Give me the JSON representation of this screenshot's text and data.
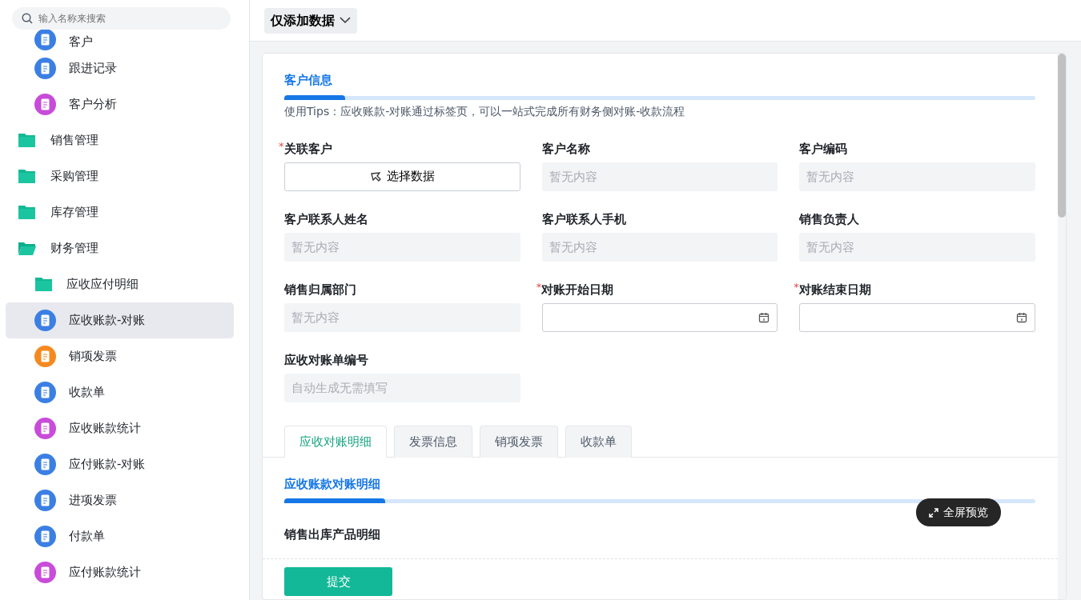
{
  "sidebar": {
    "search": {
      "placeholder": "输入名称来搜索"
    },
    "items": [
      {
        "children": [
          {
            "label": "客户",
            "kind": "app",
            "color": "#3b7fe4",
            "selected": false
          },
          {
            "label": "跟进记录",
            "kind": "app",
            "color": "#3b7fe4",
            "selected": false
          },
          {
            "label": "客户分析",
            "kind": "app",
            "color": "#c84bd9",
            "selected": false
          }
        ]
      },
      {
        "label": "销售管理",
        "kind": "folder",
        "expanded": false
      },
      {
        "label": "采购管理",
        "kind": "folder",
        "expanded": false
      },
      {
        "label": "库存管理",
        "kind": "folder",
        "expanded": false
      },
      {
        "label": "财务管理",
        "kind": "folder",
        "expanded": true,
        "children": [
          {
            "label": "应收应付明细",
            "kind": "folder",
            "expanded": false
          },
          {
            "label": "应收账款-对账",
            "kind": "app",
            "color": "#3b7fe4",
            "selected": true
          },
          {
            "label": "销项发票",
            "kind": "app",
            "color": "#f5891f",
            "selected": false
          },
          {
            "label": "收款单",
            "kind": "app",
            "color": "#3b7fe4",
            "selected": false
          },
          {
            "label": "应收账款统计",
            "kind": "app",
            "color": "#c84bd9",
            "selected": false
          },
          {
            "label": "应付账款-对账",
            "kind": "app",
            "color": "#3b7fe4",
            "selected": false
          },
          {
            "label": "进项发票",
            "kind": "app",
            "color": "#3b7fe4",
            "selected": false
          },
          {
            "label": "付款单",
            "kind": "app",
            "color": "#3b7fe4",
            "selected": false
          },
          {
            "label": "应付账款统计",
            "kind": "app",
            "color": "#c84bd9",
            "selected": false
          }
        ]
      }
    ]
  },
  "toolbar": {
    "mode_dropdown": "仅添加数据"
  },
  "form": {
    "section_title": "客户信息",
    "tip": "使用Tips：应收账款-对账通过标签页，可以一站式完成所有财务侧对账-收款流程",
    "required_mark": "*",
    "fields": [
      {
        "label": "关联客户",
        "required": true,
        "kind": "picker",
        "button": "选择数据"
      },
      {
        "label": "客户名称",
        "required": false,
        "kind": "readonly",
        "placeholder": "暂无内容"
      },
      {
        "label": "客户编码",
        "required": false,
        "kind": "readonly",
        "placeholder": "暂无内容"
      },
      {
        "label": "客户联系人姓名",
        "required": false,
        "kind": "readonly",
        "placeholder": "暂无内容"
      },
      {
        "label": "客户联系人手机",
        "required": false,
        "kind": "readonly",
        "placeholder": "暂无内容"
      },
      {
        "label": "销售负责人",
        "required": false,
        "kind": "readonly",
        "placeholder": "暂无内容"
      },
      {
        "label": "销售归属部门",
        "required": false,
        "kind": "readonly",
        "placeholder": "暂无内容"
      },
      {
        "label": "对账开始日期",
        "required": true,
        "kind": "date"
      },
      {
        "label": "对账结束日期",
        "required": true,
        "kind": "date"
      },
      {
        "label": "应收对账单编号",
        "required": false,
        "kind": "readonly",
        "placeholder": "自动生成无需填写"
      }
    ],
    "tabs": [
      {
        "label": "应收对账明细",
        "selected": true
      },
      {
        "label": "发票信息",
        "selected": false
      },
      {
        "label": "销项发票",
        "selected": false
      },
      {
        "label": "收款单",
        "selected": false
      }
    ],
    "detail_section_title": "应收账款对账明细",
    "subsection_title": "销售出库产品明细",
    "submit_button": "提交"
  },
  "fullscreen_button": "全屏预览"
}
